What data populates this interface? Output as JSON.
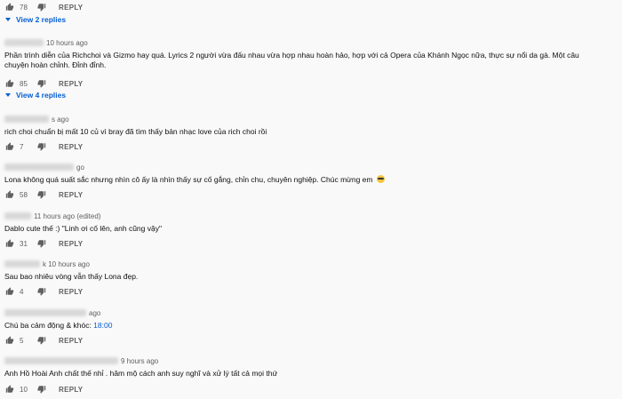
{
  "comments_top": {
    "like_count": "78",
    "reply_label": "REPLY",
    "view_replies": "View 2 replies"
  },
  "comments": [
    {
      "author": "",
      "time": "10 hours ago",
      "text": "Phần trình diễn của Richchoi và Gizmo hay quá. Lyrics 2 người vừa đấu nhau vừa hợp nhau hoàn hảo, hợp với cả Opera của Khánh Ngọc nữa, thực sự nổi da gà. Một câu chuyện hoàn chỉnh. Đỉnh đỉnh.",
      "likes": "85",
      "reply_label": "REPLY",
      "view_replies": "View 4 replies"
    },
    {
      "author": "",
      "time": "s ago",
      "text": "rich choi chuẩn bị mất 10 củ vì bray đã tìm thấy bản nhạc love của rich choi rồi",
      "likes": "7",
      "reply_label": "REPLY"
    },
    {
      "author": "",
      "time": "go",
      "text": "Lona không quá suất sắc nhưng nhìn cô ấy là nhìn thấy sự cố gắng, chỉn chu, chuyên nghiệp. Chúc mừng em",
      "likes": "58",
      "reply_label": "REPLY"
    },
    {
      "author": "",
      "time": "11 hours ago (edited)",
      "text": "Dablo cute thế :) \"Linh ơi cố lên, anh cũng vậy\"",
      "likes": "31",
      "reply_label": "REPLY"
    },
    {
      "author": "",
      "time": "k 10 hours ago",
      "text": "Sau bao nhiêu vòng vẫn thấy Lona đẹp.",
      "likes": "4",
      "reply_label": "REPLY"
    },
    {
      "author": "",
      "time": "ago",
      "text_before": "Chú ba cảm động & khóc: ",
      "timestamp_link": "18:00",
      "likes": "5",
      "reply_label": "REPLY"
    },
    {
      "author": "",
      "time": "9 hours ago",
      "text": "Anh Hồ Hoài Anh chất thế nhỉ . hâm mộ cách anh suy nghĩ và xử lý tất cả mọi thứ",
      "likes": "10",
      "reply_label": "REPLY"
    }
  ],
  "colors": {
    "background": "#f9f9f9",
    "link": "#065fd4",
    "secondary_text": "#606060"
  }
}
